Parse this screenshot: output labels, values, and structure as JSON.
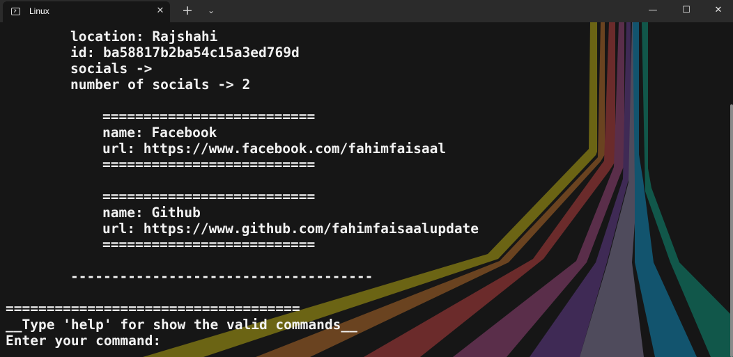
{
  "titlebar": {
    "tab_title": "Linux",
    "tab_close": "✕",
    "new_tab": "+",
    "dropdown": "⌄",
    "minimize": "—",
    "maximize": "☐",
    "close": "✕"
  },
  "terminal": {
    "location": "location: Rajshahi",
    "id": "id: ba58817b2ba54c15a3ed769d",
    "socials": "socials ->",
    "num_socials": "number of socials -> 2",
    "social1_top": "==========================",
    "social1_name": "name: Facebook",
    "social1_url": "url: https://www.facebook.com/fahimfaisaal",
    "social1_bottom": "==========================",
    "social2_top": "==========================",
    "social2_name": "name: Github",
    "social2_url": "url: https://www.github.com/fahimfaisaalupdate",
    "social2_bottom": "==========================",
    "dash_separator": "-------------------------------------",
    "equals_separator": "====================================",
    "help_hint": "__Type 'help' for show the valid commands__",
    "prompt": "Enter your command:"
  },
  "colors": {
    "terminal_bg": "#161616",
    "titlebar_bg": "#2b2b2b",
    "text": "#f2f2f2",
    "stripe_olive": "#6b6414",
    "stripe_brown": "#6a4320",
    "stripe_red": "#6b2b2b",
    "stripe_plum": "#5a2e4a",
    "stripe_purple": "#3f2a55",
    "stripe_gray": "#4f4b5c",
    "stripe_blue": "#12546e",
    "stripe_teal": "#11574a"
  }
}
